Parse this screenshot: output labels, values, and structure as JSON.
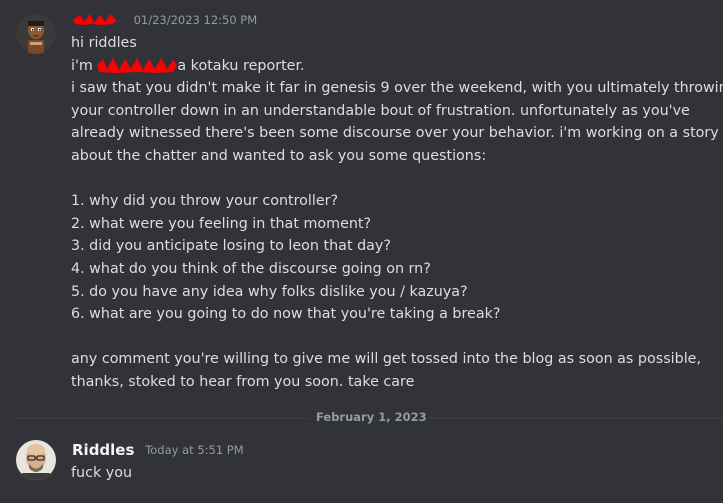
{
  "messages": [
    {
      "author": "",
      "timestamp": "01/23/2023 12:50 PM",
      "lines": {
        "l0": "hi riddles",
        "l1_pre": "i'm ",
        "l1_post": "a kotaku reporter.",
        "l2": "i saw that you didn't make it far in genesis 9 over the weekend, with you ultimately throwing",
        "l3": "your controller down in an understandable bout of frustration. unfortunately as you've",
        "l4": "already witnessed there's been some discourse over your behavior. i'm working on a story",
        "l5": "about the chatter and wanted to ask you some questions:",
        "l7": "1. why did you throw your controller?",
        "l8": "2. what were you feeling in that moment?",
        "l9": "3. did you anticipate losing to leon that day?",
        "l10": "4. what do you think of the discourse going on rn?",
        "l11": "5. do you have any idea why folks dislike you / kazuya?",
        "l12": "6. what are you going to do now that you're taking a break?",
        "l14": "any comment you're willing to give me will get tossed into the blog as soon as possible,",
        "l15": "thanks, stoked to hear from you soon. take care"
      }
    },
    {
      "author": "Riddles",
      "timestamp": "Today at 5:51 PM",
      "text": "fuck you"
    }
  ],
  "date_divider": "February 1, 2023",
  "colors": {
    "background": "#313338",
    "text": "#dbdee1",
    "username": "#f2f3f5",
    "muted": "#949ba4",
    "redaction": "#ff0000"
  },
  "icons": {
    "avatar_1": "cartoon-character-avatar",
    "avatar_2": "bald-man-avatar"
  }
}
